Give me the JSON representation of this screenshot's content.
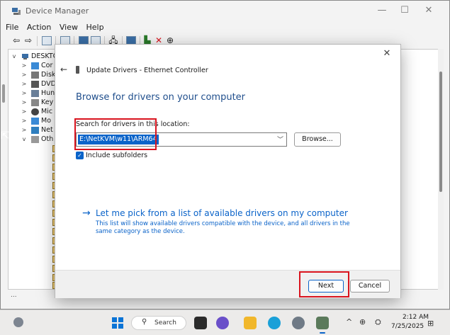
{
  "device_manager": {
    "title": "Device Manager",
    "menu": [
      "File",
      "Action",
      "View",
      "Help"
    ],
    "tree": {
      "root": "DESKTO",
      "items": [
        "Cor",
        "Disk",
        "DVD",
        "Hun",
        "Key",
        "Mic",
        "Mo",
        "Net",
        "Oth"
      ]
    },
    "status_text": "..."
  },
  "dialog": {
    "title": "Update Drivers - Ethernet Controller",
    "heading": "Browse for drivers on your computer",
    "search_label": "Search for drivers in this location:",
    "path_value": "E:\\NetKVM\\w11\\ARM64",
    "browse_label": "Browse...",
    "include_subfolders_label": "Include subfolders",
    "include_subfolders_checked": true,
    "pick_link": "Let me pick from a list of available drivers on my computer",
    "pick_description": "This list will show available drivers compatible with the device, and all drivers in the same category as the device.",
    "next_label": "Next",
    "cancel_label": "Cancel",
    "close_glyph": "✕",
    "back_glyph": "←"
  },
  "window_controls": {
    "minimize": "—",
    "maximize": "☐",
    "close": "✕"
  },
  "taskbar": {
    "search_label": "Search",
    "time": "2:12 AM",
    "date": "7/25/2025"
  },
  "colors": {
    "accent": "#0a63c9",
    "heading_blue": "#1f4e8c",
    "highlight_red": "#d9141e"
  }
}
